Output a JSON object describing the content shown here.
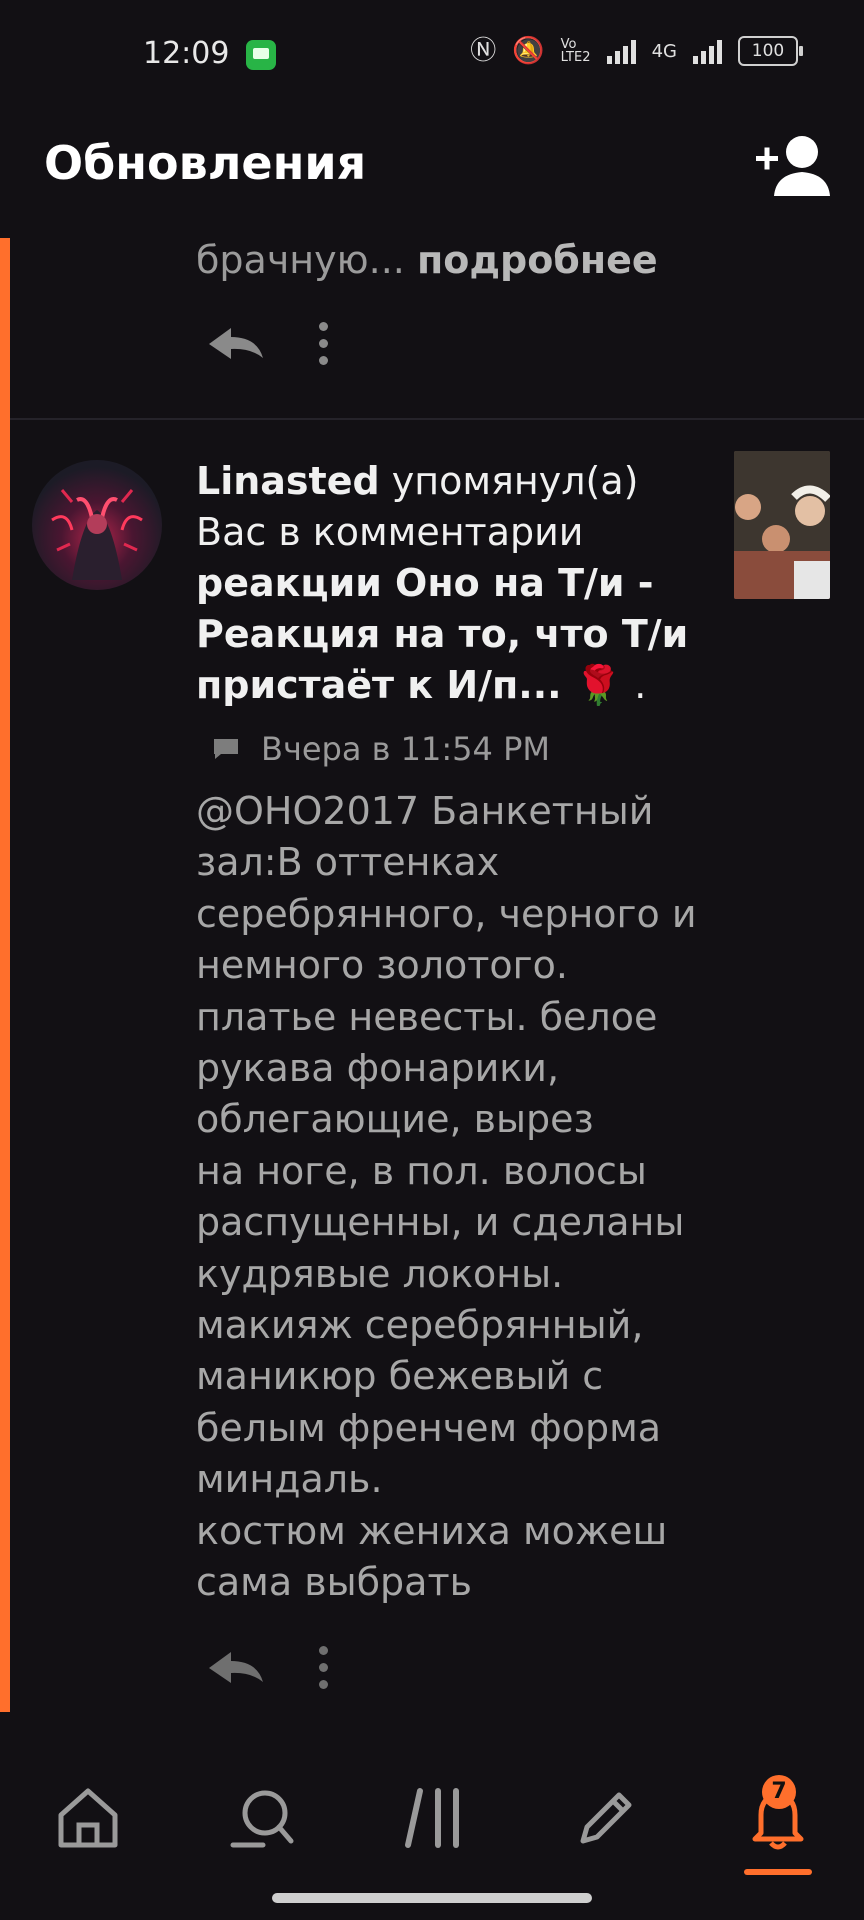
{
  "status_bar": {
    "time": "12:09",
    "volte": "Vo LTE2",
    "network": "4G",
    "battery": "100"
  },
  "header": {
    "title": "Обновления"
  },
  "previous_item": {
    "text": "брачную...",
    "more_link": "подробнее"
  },
  "notification": {
    "user": "Linasted",
    "action": "упомянул(а) Вас в комментарии",
    "story_title": "реакции Оно на Т/и - Реакция на то, что Т/и пристаёт к И/п... 🌹",
    "title_end": ".",
    "timestamp": "Вчера в 11:54 PM",
    "comment": "@ОНО2017 Банкетный\nзал:В оттенках\nсеребрянного, черного и\nнемного золотого.\nплатье невесты. белое\nрукава фонарики,\nоблегающие, вырез\nна ноге, в пол. волосы\nраспущенны, и сделаны\nкудрявые локоны.\nмакияж серебрянный,\nманикюр бежевый с\nбелым френчем форма\nминдаль.\nкостюм жениха можеш\nсама выбрать"
  },
  "bottom_nav": {
    "items": [
      "home-icon",
      "search-icon",
      "library-icon",
      "write-icon",
      "notifications-icon"
    ],
    "active": "notifications-icon",
    "badge": "7"
  },
  "colors": {
    "accent": "#ff6f2c",
    "background": "#121014"
  }
}
